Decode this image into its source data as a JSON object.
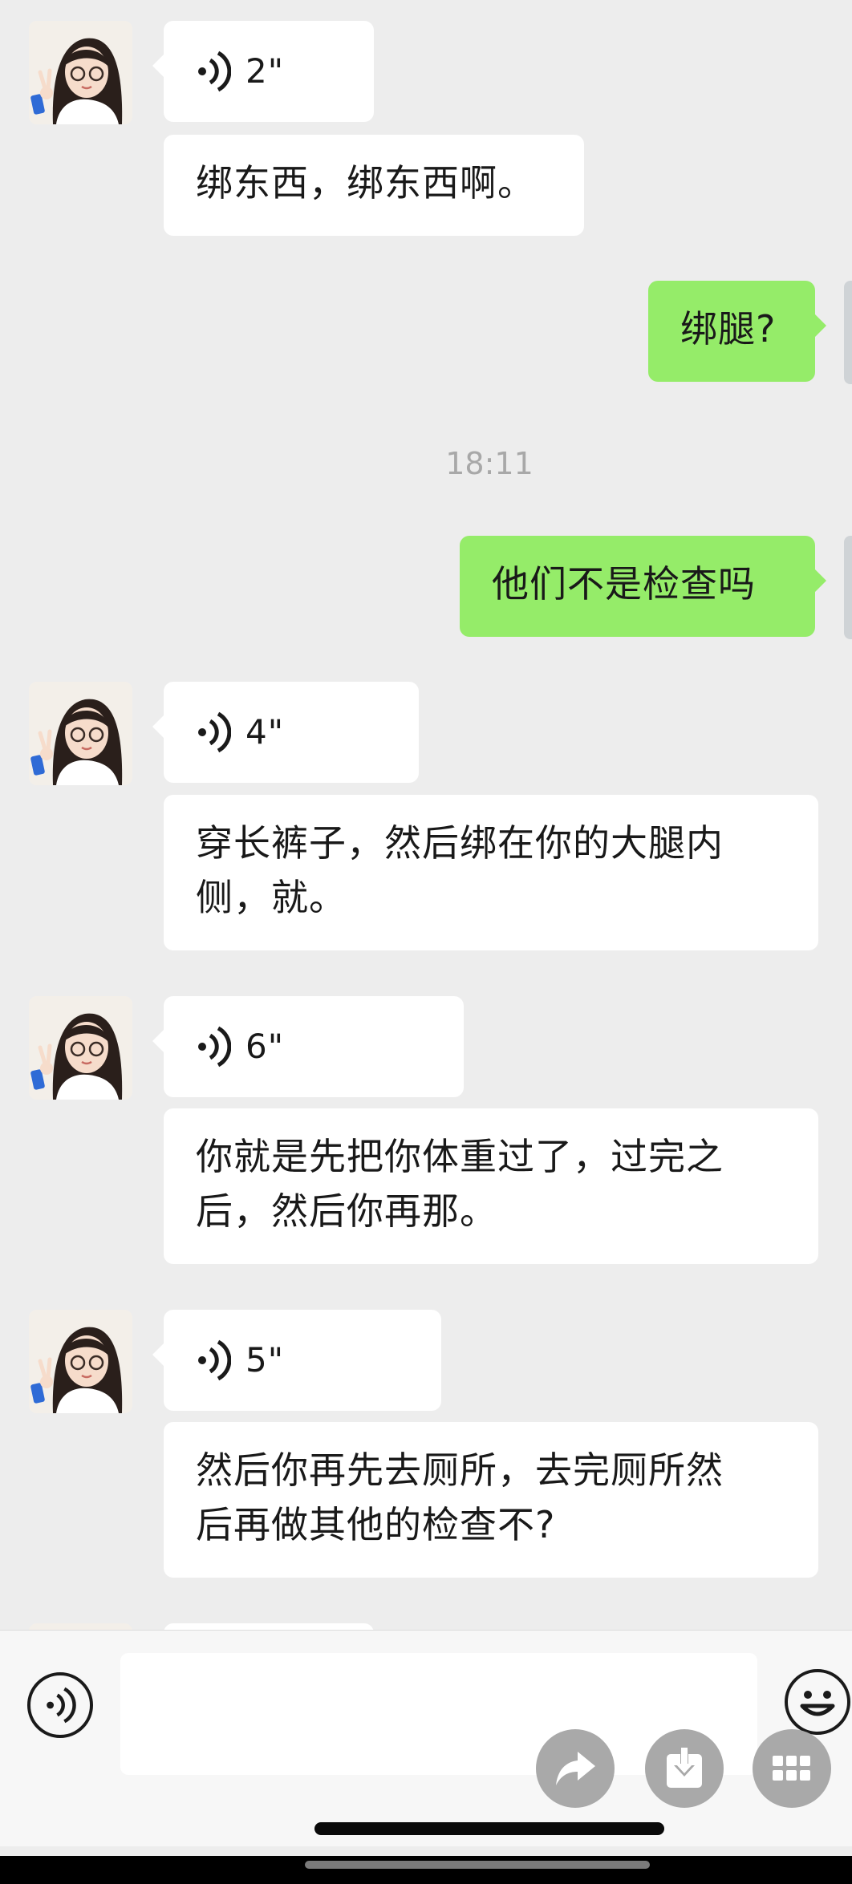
{
  "messages": [
    {
      "type": "voice",
      "side": "left",
      "duration": "2\""
    },
    {
      "type": "text",
      "side": "left",
      "text": "绑东西，绑东西啊。"
    },
    {
      "type": "text",
      "side": "right",
      "text": "绑腿?"
    },
    {
      "type": "time",
      "text": "18:11"
    },
    {
      "type": "text",
      "side": "right",
      "text": "他们不是检查吗"
    },
    {
      "type": "voice",
      "side": "left",
      "duration": "4\""
    },
    {
      "type": "text",
      "side": "left",
      "lines": [
        "穿长裤子，然后绑在你的大腿内",
        "侧，就。"
      ]
    },
    {
      "type": "voice",
      "side": "left",
      "duration": "6\""
    },
    {
      "type": "text",
      "side": "left",
      "lines": [
        "你就是先把你体重过了，过完之",
        "后，然后你再那。"
      ]
    },
    {
      "type": "voice",
      "side": "left",
      "duration": "5\""
    },
    {
      "type": "text",
      "side": "left",
      "lines": [
        "然后你再先去厕所，去完厕所然",
        "后再做其他的检查不?"
      ]
    }
  ],
  "colors": {
    "background": "#ededed",
    "incoming_bubble": "#ffffff",
    "outgoing_bubble": "#95ec69",
    "timestamp": "#a8a8a8"
  },
  "input_bar": {
    "voice_icon": "voice-mode-icon",
    "emoji_icon": "emoji-smile-icon",
    "actions": [
      "forward-icon",
      "save-download-icon",
      "more-grid-icon"
    ]
  }
}
